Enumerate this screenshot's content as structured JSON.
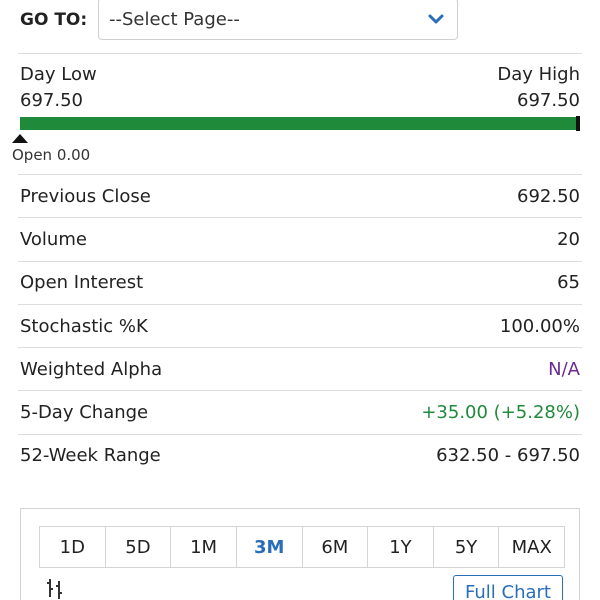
{
  "goto": {
    "label": "GO TO:",
    "select_value": "--Select Page--"
  },
  "range": {
    "day_low_label": "Day Low",
    "day_low_value": "697.50",
    "day_high_label": "Day High",
    "day_high_value": "697.50",
    "fill_fraction": 1.0,
    "open_label": "Open 0.00"
  },
  "stats": [
    {
      "label": "Previous Close",
      "value": "692.50"
    },
    {
      "label": "Volume",
      "value": "20"
    },
    {
      "label": "Open Interest",
      "value": "65"
    },
    {
      "label": "Stochastic %K",
      "value": "100.00%"
    },
    {
      "label": "Weighted Alpha",
      "value": "N/A"
    },
    {
      "label": "5-Day Change",
      "value": "+35.00 (+5.28%)"
    },
    {
      "label": "52-Week Range",
      "value": "632.50 - 697.50"
    }
  ],
  "chart": {
    "periods": [
      "1D",
      "5D",
      "1M",
      "3M",
      "6M",
      "1Y",
      "5Y",
      "MAX"
    ],
    "active_period": "3M",
    "full_chart_label": "Full Chart"
  },
  "colors": {
    "accent": "#2a6ebb",
    "positive": "#1f8a3a",
    "na": "#6a2c91"
  }
}
